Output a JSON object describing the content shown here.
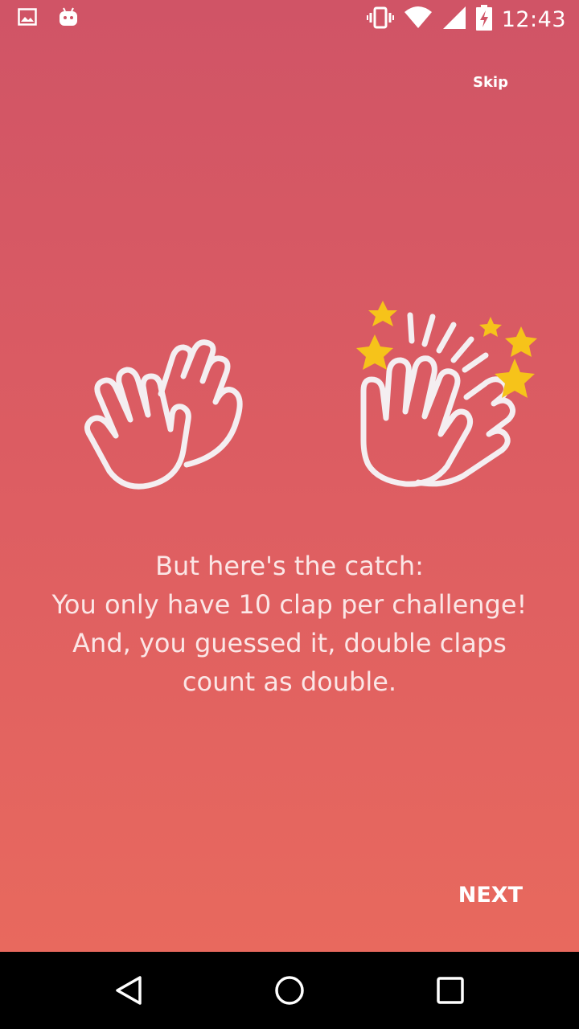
{
  "status_bar": {
    "time": "12:43",
    "icons": [
      "image-icon",
      "android-icon",
      "vibrate-icon",
      "wifi-icon",
      "signal-icon",
      "battery-charging-icon"
    ]
  },
  "header": {
    "skip_label": "Skip"
  },
  "illustration": {
    "icons": [
      "clapping-hands-icon",
      "clapping-hands-stars-icon"
    ],
    "star_color": "#f6c31a",
    "outline_color": "#ffffff"
  },
  "message": {
    "lines": [
      "But here's the catch:",
      "You only have 10 clap per challenge!",
      "And, you guessed it, double claps",
      "count as double."
    ]
  },
  "footer": {
    "next_label": "NEXT"
  },
  "nav_bar": {
    "icons": [
      "back-icon",
      "home-icon",
      "recents-icon"
    ]
  },
  "colors": {
    "gradient_top": "#d05466",
    "gradient_bottom": "#e8695e"
  }
}
